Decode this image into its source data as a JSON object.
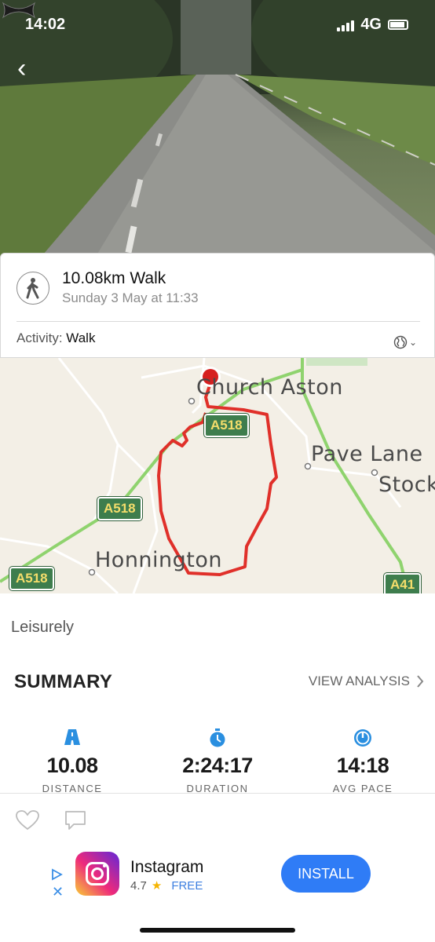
{
  "status_bar": {
    "time": "14:02",
    "network": "4G"
  },
  "activity": {
    "title": "10.08km Walk",
    "date": "Sunday 3 May at 11:33",
    "type_label": "Activity:",
    "type_value": "Walk"
  },
  "map": {
    "places": [
      "Church Aston",
      "Pave Lane",
      "Stock",
      "Honnington"
    ],
    "roads": [
      "A518",
      "A518",
      "A518",
      "A41"
    ],
    "route_color": "#e0302a"
  },
  "feel": "Leisurely",
  "summary": {
    "title": "SUMMARY",
    "view_analysis": "VIEW ANALYSIS",
    "stats": [
      {
        "value": "10.08",
        "label": "DISTANCE",
        "icon": "road-icon"
      },
      {
        "value": "2:24:17",
        "label": "DURATION",
        "icon": "stopwatch-icon"
      },
      {
        "value": "14:18",
        "label": "AVG PACE",
        "icon": "speedometer-icon"
      }
    ]
  },
  "ad": {
    "app_name": "Instagram",
    "rating": "4.7",
    "price": "FREE",
    "install": "INSTALL"
  },
  "colors": {
    "accent": "#2f7cf6",
    "stat_icon": "#2a8fe0"
  }
}
